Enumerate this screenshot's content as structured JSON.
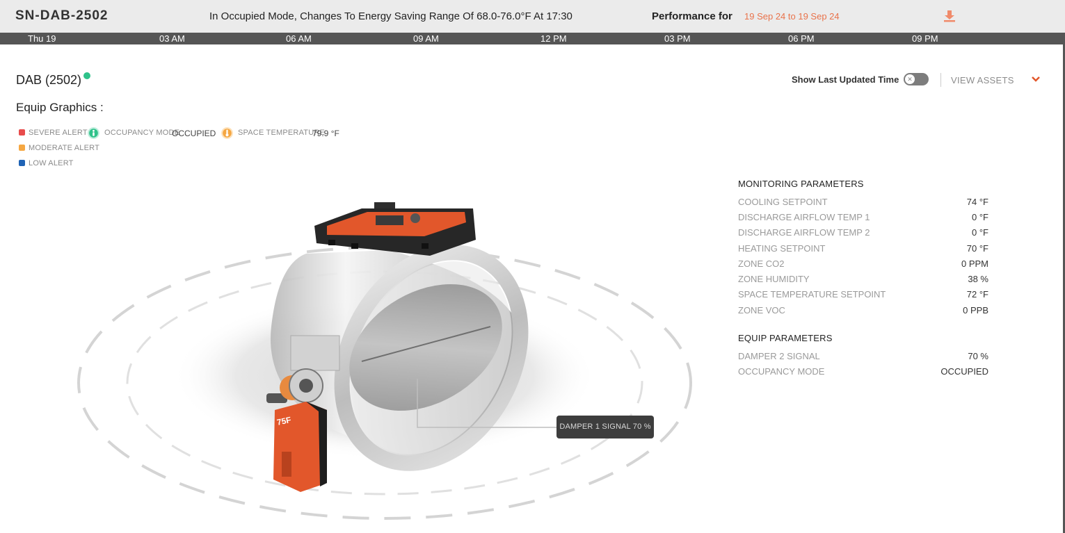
{
  "header": {
    "equip_id": "SN-DAB-2502",
    "mode_message": "In Occupied Mode, Changes To Energy Saving Range Of 68.0-76.0°F At 17:30",
    "performance_label": "Performance for",
    "performance_range": "19 Sep 24 to 19 Sep 24",
    "download_icon": "download-icon"
  },
  "timeline": {
    "labels": [
      "Thu 19",
      "03 AM",
      "06 AM",
      "09 AM",
      "12 PM",
      "03 PM",
      "06 PM",
      "09 PM"
    ]
  },
  "equip": {
    "title": "DAB (2502)",
    "status_color": "#2fc28a",
    "graphics_label": "Equip Graphics :"
  },
  "controls": {
    "show_last_updated": "Show Last Updated Time",
    "toggle_on": false,
    "view_assets": "VIEW ASSETS"
  },
  "legend": {
    "severe": {
      "label": "SEVERE ALERT",
      "color": "#e84c4c"
    },
    "moderate": {
      "label": "MODERATE ALERT",
      "color": "#f5a742"
    },
    "low": {
      "label": "LOW ALERT",
      "color": "#1f63b5"
    },
    "occupancy": {
      "label": "OCCUPANCY MODE",
      "value": "OCCUPIED",
      "color": "#2fc28a",
      "icon": "person-icon"
    },
    "space_temp": {
      "label": "SPACE TEMPERATURE",
      "value": "79.9 °F",
      "color": "#f5a742",
      "icon": "thermometer-icon"
    }
  },
  "monitoring": {
    "title": "MONITORING PARAMETERS",
    "rows": [
      {
        "name": "COOLING SETPOINT",
        "value": "74 °F"
      },
      {
        "name": "DISCHARGE AIRFLOW TEMP 1",
        "value": "0 °F"
      },
      {
        "name": "DISCHARGE AIRFLOW TEMP 2",
        "value": "0 °F"
      },
      {
        "name": "HEATING SETPOINT",
        "value": "70 °F"
      },
      {
        "name": "ZONE CO2",
        "value": "0 PPM"
      },
      {
        "name": "ZONE HUMIDITY",
        "value": "38 %"
      },
      {
        "name": "SPACE TEMPERATURE SETPOINT",
        "value": "72 °F"
      },
      {
        "name": "ZONE VOC",
        "value": "0 PPB"
      }
    ]
  },
  "equip_params": {
    "title": "EQUIP PARAMETERS",
    "rows": [
      {
        "name": "DAMPER 2 SIGNAL",
        "value": "70 %"
      },
      {
        "name": "OCCUPANCY MODE",
        "value": "OCCUPIED"
      }
    ]
  },
  "graphic": {
    "damper_label": "DAMPER 1 SIGNAL 70 %",
    "actuator_brand": "75F"
  }
}
